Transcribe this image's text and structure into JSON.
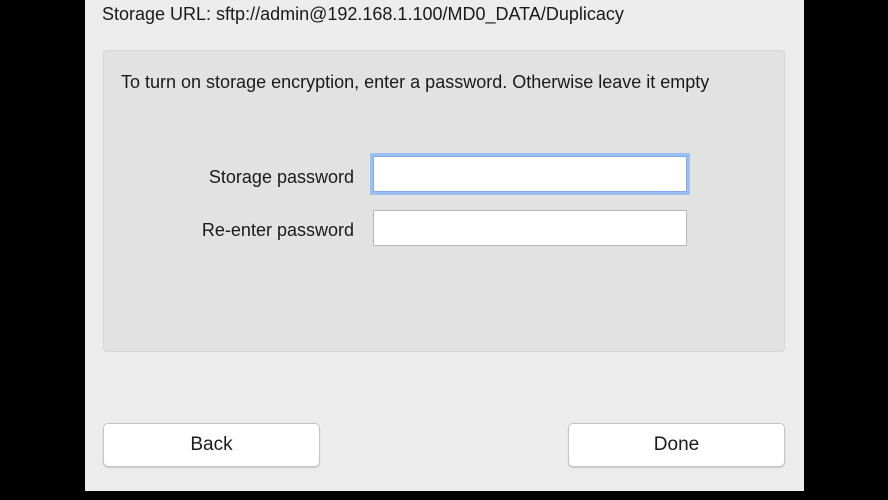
{
  "dialog": {
    "storage_url": "Storage URL: sftp://admin@192.168.1.100/MD0_DATA/Duplicacy",
    "instructions": "To turn on storage encryption, enter a password.  Otherwise leave it empty",
    "fields": {
      "storage_password_label": "Storage password",
      "storage_password_value": "",
      "reenter_password_label": "Re-enter password",
      "reenter_password_value": ""
    },
    "buttons": {
      "back_label": "Back",
      "done_label": "Done"
    }
  },
  "colors": {
    "focus_ring": "#9dc0f2",
    "dialog_bg": "#ececec",
    "panel_bg": "#e2e2e2"
  }
}
